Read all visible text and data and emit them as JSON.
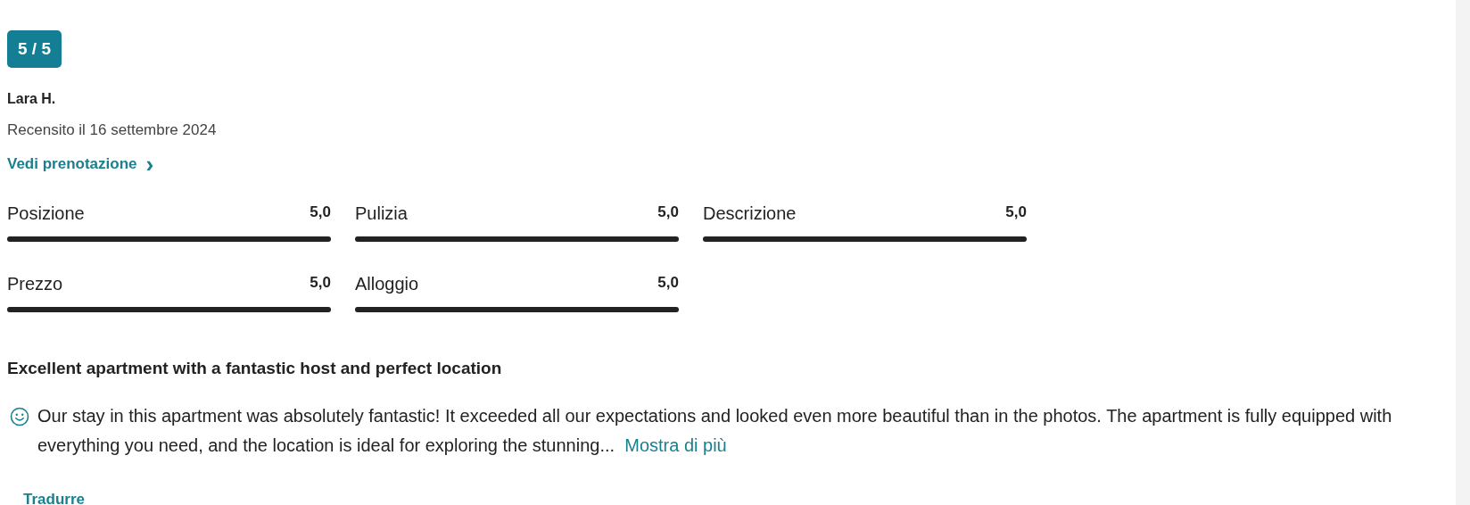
{
  "score_badge": "5 / 5",
  "reviewer": {
    "name": "Lara H.",
    "date": "Recensito il 16 settembre 2024"
  },
  "booking_link": {
    "label": "Vedi prenotazione",
    "icon": "›"
  },
  "subscores": [
    {
      "label": "Posizione",
      "value": "5,0",
      "level": 1.0
    },
    {
      "label": "Pulizia",
      "value": "5,0",
      "level": 1.0
    },
    {
      "label": "Descrizione",
      "value": "5,0",
      "level": 1.0
    },
    {
      "label": "Prezzo",
      "value": "5,0",
      "level": 1.0
    },
    {
      "label": "Alloggio",
      "value": "5,0",
      "level": 1.0
    }
  ],
  "review": {
    "title": "Excellent apartment with a fantastic host and perfect location",
    "text": "Our stay in this apartment was absolutely fantastic! It exceeded all our expectations and looked even more beautiful than in the photos. The apartment is fully equipped with everything you need, and the location is ideal for exploring the stunning...",
    "more_link": "Mostra di più"
  },
  "translate_link": "Tradurre"
}
